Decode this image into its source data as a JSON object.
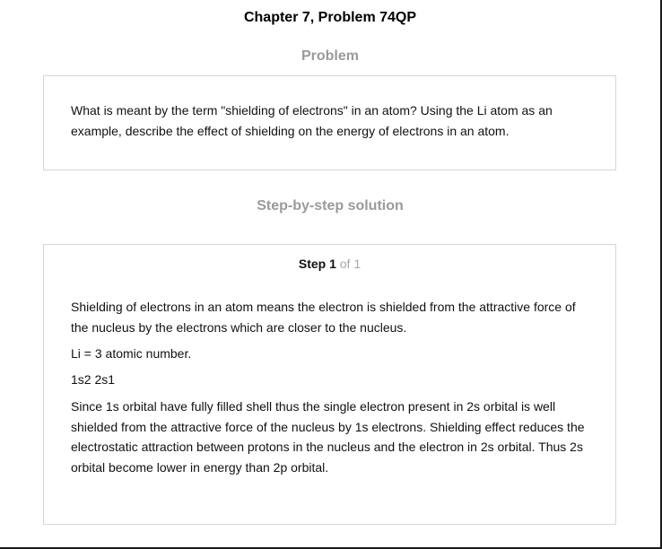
{
  "header": {
    "title": "Chapter 7, Problem 74QP"
  },
  "problem": {
    "heading": "Problem",
    "text": "What is meant by the term \"shielding of electrons\" in an atom? Using the Li atom as an example, describe the effect of shielding on the energy of electrons in an atom."
  },
  "solution": {
    "heading": "Step-by-step solution",
    "step": {
      "label": "Step 1",
      "of_text": "of 1"
    },
    "paragraphs": [
      "Shielding of electrons in an atom means the electron is shielded from the attractive force of the nucleus by the electrons which are closer to the nucleus.",
      "Li = 3 atomic number.",
      "1s2 2s1",
      "Since 1s orbital have fully filled shell thus the single electron present in 2s orbital is well shielded from the attractive force of the nucleus by 1s electrons. Shielding effect reduces the electrostatic attraction between protons in the nucleus and the electron in 2s orbital. Thus 2s orbital become lower in energy than 2p orbital."
    ]
  }
}
